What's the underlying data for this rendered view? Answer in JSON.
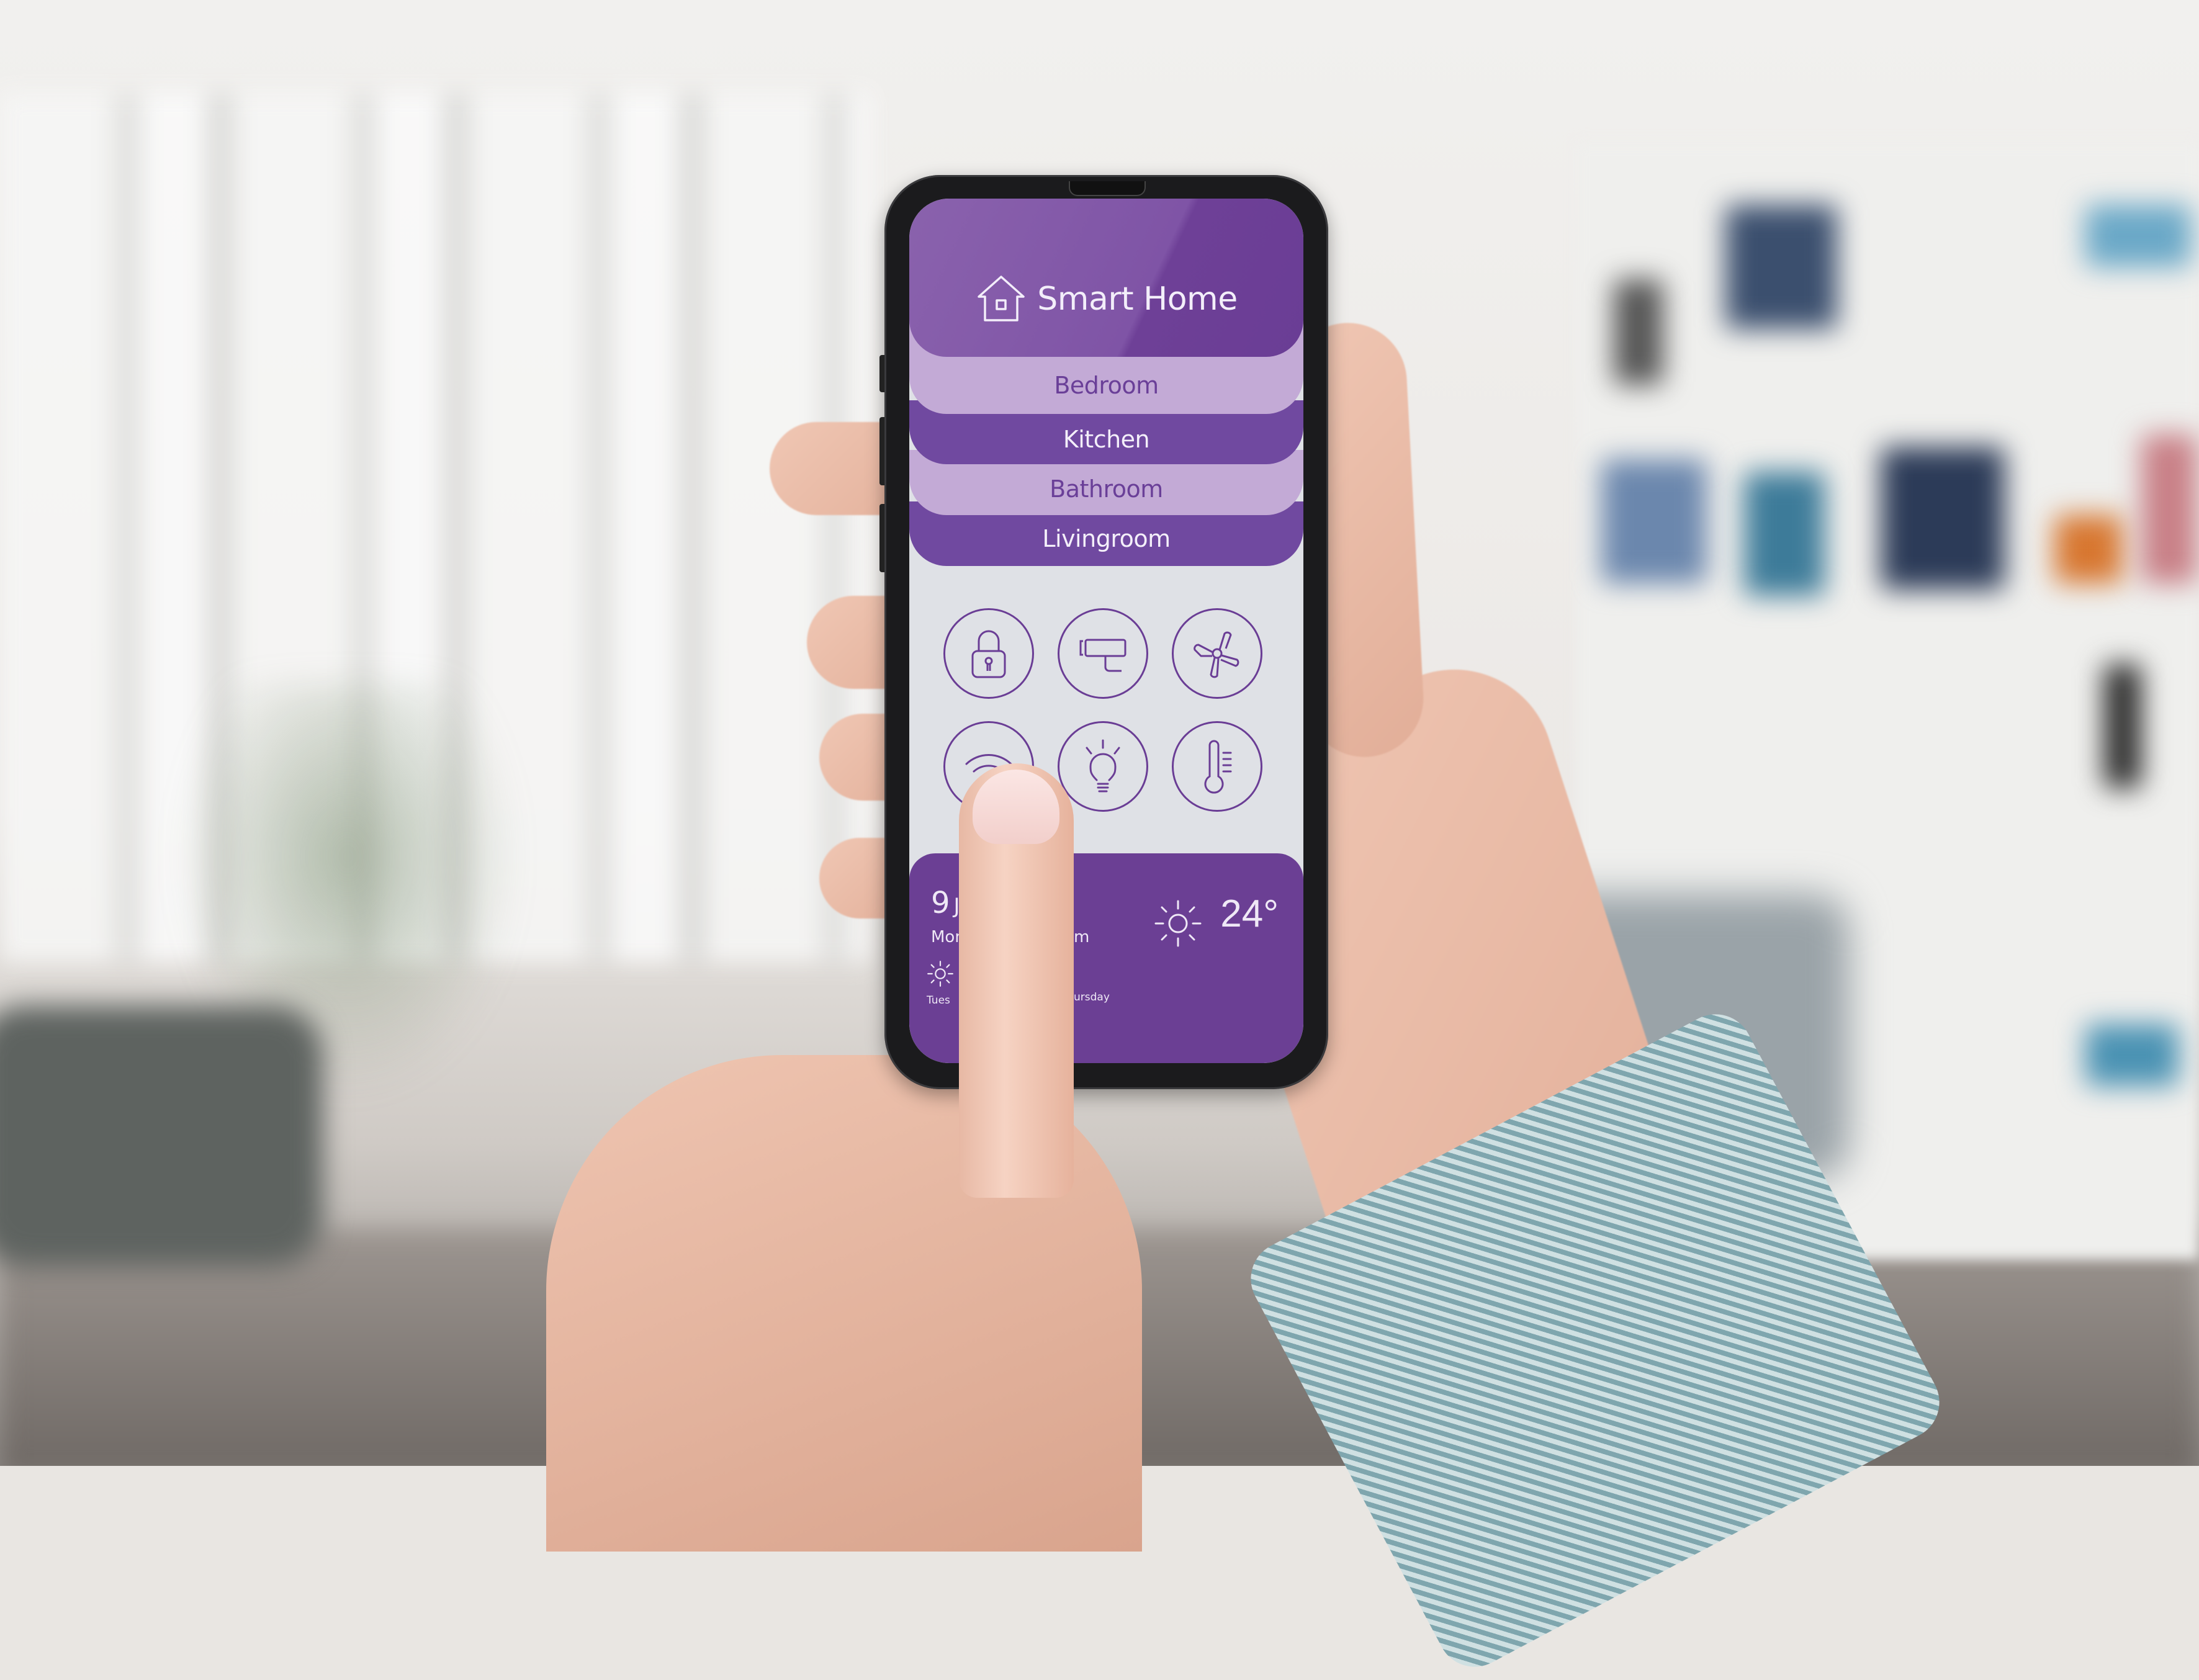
{
  "app": {
    "title": "Smart Home",
    "title_icon": "house-icon",
    "accent_color": "#6b3f94",
    "light_band_color": "#c3aad6"
  },
  "rooms": [
    {
      "label": "Bedroom",
      "style": "light"
    },
    {
      "label": "Kitchen",
      "style": "dark"
    },
    {
      "label": "Bathroom",
      "style": "light"
    },
    {
      "label": "Livingroom",
      "style": "dark"
    }
  ],
  "controls": [
    {
      "name": "lock",
      "icon": "padlock-icon"
    },
    {
      "name": "security-camera",
      "icon": "camera-icon"
    },
    {
      "name": "fan",
      "icon": "fan-icon"
    },
    {
      "name": "wifi",
      "icon": "wifi-icon"
    },
    {
      "name": "light",
      "icon": "lightbulb-icon"
    },
    {
      "name": "temperature",
      "icon": "thermometer-icon"
    }
  ],
  "weather": {
    "day": "9",
    "month_partial": "Ju",
    "weekday_partial": "Mon",
    "time_partial": "m",
    "current_temp": "24°",
    "current_icon": "sun-icon",
    "forecast": [
      {
        "label": "Tues",
        "icon": "sun-icon"
      },
      {
        "label": "ursday",
        "icon": "sun-icon"
      }
    ]
  }
}
